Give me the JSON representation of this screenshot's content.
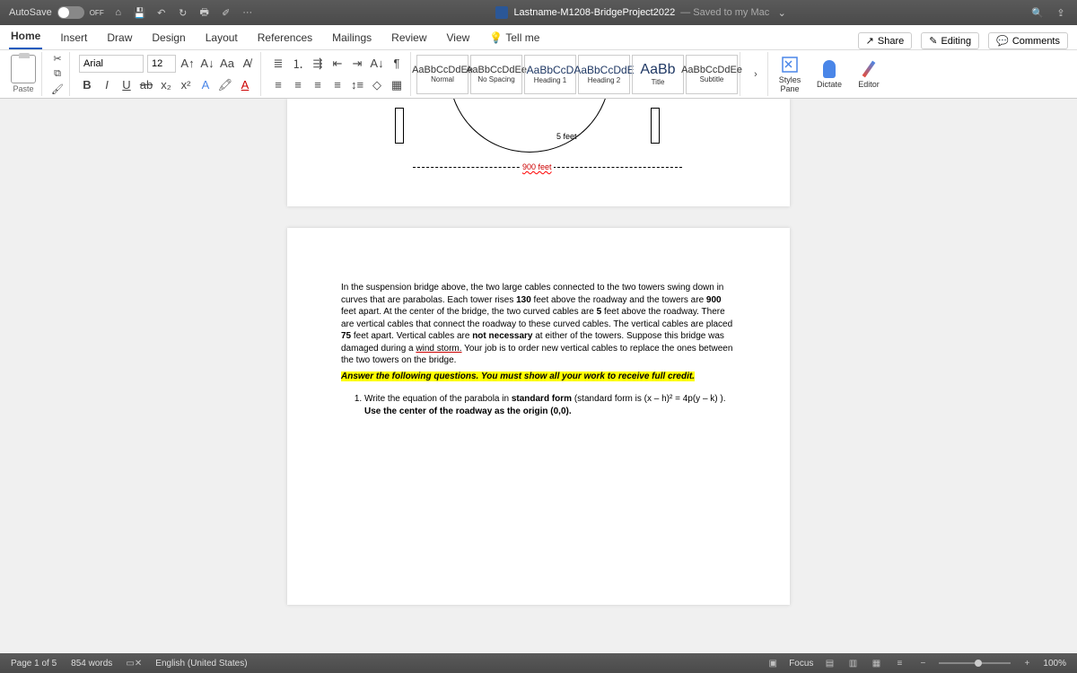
{
  "titlebar": {
    "autosave_label": "AutoSave",
    "autosave_state": "OFF",
    "doc_title": "Lastname-M1208-BridgeProject2022",
    "saved_text": "— Saved to my Mac",
    "ellipsis": "···"
  },
  "tabs": {
    "items": [
      "Home",
      "Insert",
      "Draw",
      "Design",
      "Layout",
      "References",
      "Mailings",
      "Review",
      "View"
    ],
    "active": "Home",
    "tellme": "Tell me",
    "share": "Share",
    "editing": "Editing",
    "comments": "Comments"
  },
  "ribbon": {
    "paste": "Paste",
    "font_name": "Arial",
    "font_size": "12",
    "bold": "B",
    "italic": "I",
    "underline": "U",
    "strike": "ab",
    "sub": "x₂",
    "sup": "x²",
    "aa": "Aa",
    "styles": [
      {
        "preview": "AaBbCcDdEe",
        "name": "Normal",
        "cls": ""
      },
      {
        "preview": "AaBbCcDdEe",
        "name": "No Spacing",
        "cls": ""
      },
      {
        "preview": "AaBbCcD",
        "name": "Heading 1",
        "cls": "med"
      },
      {
        "preview": "AaBbCcDdE",
        "name": "Heading 2",
        "cls": "med"
      },
      {
        "preview": "AaBb",
        "name": "Title",
        "cls": "big"
      },
      {
        "preview": "AaBbCcDdEe",
        "name": "Subtitle",
        "cls": ""
      }
    ],
    "styles_pane": "Styles\nPane",
    "dictate": "Dictate",
    "editor": "Editor"
  },
  "document": {
    "label_5feet": "5 feet",
    "label_900feet": "900 feet",
    "paragraph_html": "In the suspension bridge above, the two large cables connected to the two towers swing down in curves that are parabolas.  Each tower rises <b>130</b> feet above the roadway and the towers are <b>900</b> feet apart.  At the center of the bridge, the two curved cables are <b>5</b> feet above the roadway.  There are vertical cables that connect the roadway to these curved cables.  The vertical cables are placed <b>75</b> feet apart.  Vertical cables are <b>not necessary</b> at either of the towers.  Suppose this bridge was damaged during a <span class='wavy'>wind storm.</span>  Your job is to order new vertical cables to replace the ones between the two towers on the bridge.",
    "highlight": "Answer the following questions.  You must show all your work to receive full credit.",
    "q1_html": "Write the equation of the parabola in <b>standard form</b> (standard form is (x – h)² = <span class='wavy'>4p(y</span> – k)  ). <b>Use the center of the roadway as the origin (0,0).</b>"
  },
  "statusbar": {
    "page": "Page 1 of 5",
    "words": "854 words",
    "lang": "English (United States)",
    "focus": "Focus",
    "zoom": "100%",
    "minus": "−",
    "plus": "+"
  }
}
